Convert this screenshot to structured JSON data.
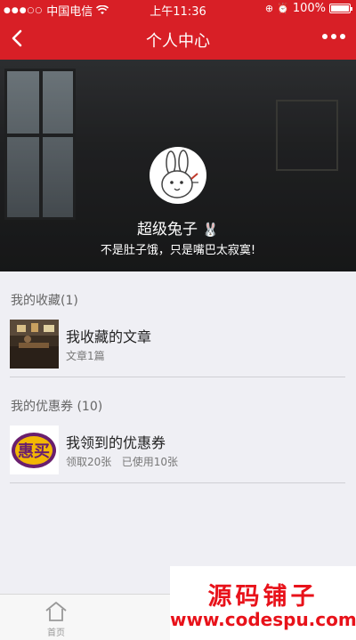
{
  "status_bar": {
    "carrier": "中国电信",
    "time": "上午11:36",
    "battery": "100%",
    "battery_level": 1.0
  },
  "nav": {
    "title": "个人中心",
    "back_icon": "chevron-left-icon",
    "more_icon": "more-dots-icon"
  },
  "profile": {
    "nickname": "超级兔子",
    "signature": "不是肚子饿，只是嘴巴太寂寞!"
  },
  "favorites": {
    "header": "我的收藏(1)",
    "item": {
      "name": "我收藏的文章",
      "detail": "文章1篇"
    }
  },
  "coupons": {
    "header": "我的优惠券 (10)",
    "item": {
      "name": "我领到的优惠券",
      "detail": "领取20张   已使用10张"
    }
  },
  "tabbar": {
    "items": [
      {
        "label": "首页",
        "icon": "home-icon"
      },
      {
        "label": "",
        "icon": "tab-icon"
      }
    ]
  },
  "watermark": {
    "title": "源码铺子",
    "url": "www.codespu.com"
  },
  "colors": {
    "accent": "#d81f26",
    "background": "#efeff4"
  }
}
